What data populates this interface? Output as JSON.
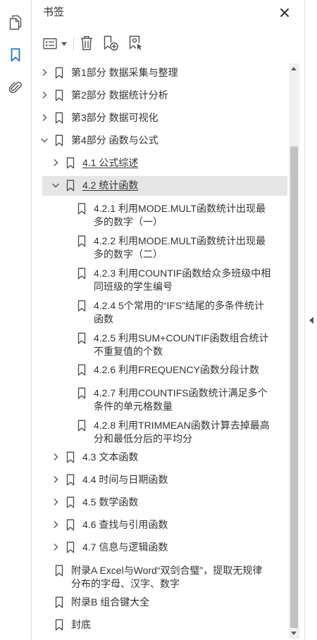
{
  "colors": {
    "accent": "#1473e6",
    "text": "#333333",
    "selection": "#e5e5e5",
    "scroll_thumb": "#c1c1c1",
    "scroll_track": "#f0f0f0"
  },
  "sidebar": {
    "tools": [
      {
        "icon": "pages-icon",
        "active": false
      },
      {
        "icon": "bookmark-icon",
        "active": true
      },
      {
        "icon": "paperclip-icon",
        "active": false
      }
    ]
  },
  "panel": {
    "title": "书签",
    "close_icon": "close-icon"
  },
  "toolbar": {
    "buttons": [
      {
        "icon": "options-icon"
      },
      {
        "icon": "dropdown-caret-icon"
      },
      {
        "icon": "trash-icon"
      },
      {
        "icon": "new-bookmark-icon"
      },
      {
        "icon": "find-current-bookmark-icon"
      }
    ]
  },
  "bookmarks": [
    {
      "depth": 0,
      "toggle_icon": "chevron-right-icon",
      "expanded": false,
      "lines": [
        "第1部分 数据采集与整理"
      ]
    },
    {
      "depth": 0,
      "toggle_icon": "chevron-right-icon",
      "expanded": false,
      "lines": [
        "第2部分 数据统计分析"
      ]
    },
    {
      "depth": 0,
      "toggle_icon": "chevron-right-icon",
      "expanded": false,
      "lines": [
        "第3部分 数据可视化"
      ]
    },
    {
      "depth": 0,
      "toggle_icon": "chevron-down-icon",
      "expanded": true,
      "lines": [
        "第4部分 函数与公式"
      ]
    },
    {
      "depth": 1,
      "toggle_icon": "chevron-right-icon",
      "expanded": false,
      "lines": [
        "4.1 公式综述"
      ]
    },
    {
      "depth": 1,
      "toggle_icon": "chevron-down-icon",
      "expanded": true,
      "selected": true,
      "lines": [
        "4.2 统计函数"
      ]
    },
    {
      "depth": 2,
      "lines": [
        "4.2.1 利用MODE.MULT函数统计出现最",
        "多的数字（一）"
      ]
    },
    {
      "depth": 2,
      "lines": [
        "4.2.2 利用MODE.MULT函数统计出现最",
        "多的数字（二）"
      ]
    },
    {
      "depth": 2,
      "lines": [
        "4.2.3 利用COUNTIF函数给众多班级中相",
        "同班级的学生编号"
      ]
    },
    {
      "depth": 2,
      "lines": [
        "4.2.4 5个常用的“IFS”结尾的多条件统计",
        "函数"
      ]
    },
    {
      "depth": 2,
      "lines": [
        "4.2.5 利用SUM+COUNTIF函数组合统计",
        "不重复值的个数"
      ]
    },
    {
      "depth": 2,
      "lines": [
        "4.2.6 利用FREQUENCY函数分段计数"
      ]
    },
    {
      "depth": 2,
      "lines": [
        "4.2.7 利用COUNTIFS函数统计满足多个",
        "条件的单元格数量"
      ]
    },
    {
      "depth": 2,
      "lines": [
        "4.2.8 利用TRIMMEAN函数计算去掉最高",
        "分和最低分后的平均分"
      ]
    },
    {
      "depth": 1,
      "toggle_icon": "chevron-right-icon",
      "expanded": false,
      "lines": [
        "4.3 文本函数"
      ]
    },
    {
      "depth": 1,
      "toggle_icon": "chevron-right-icon",
      "expanded": false,
      "lines": [
        "4.4 时间与日期函数"
      ]
    },
    {
      "depth": 1,
      "toggle_icon": "chevron-right-icon",
      "expanded": false,
      "lines": [
        "4.5 数学函数"
      ]
    },
    {
      "depth": 1,
      "toggle_icon": "chevron-right-icon",
      "expanded": false,
      "lines": [
        "4.6 查找与引用函数"
      ]
    },
    {
      "depth": 1,
      "toggle_icon": "chevron-right-icon",
      "expanded": false,
      "lines": [
        "4.7 信息与逻辑函数"
      ]
    },
    {
      "depth": 0,
      "lines": [
        "附录A Excel与Word“双剑合璧”，提取无规律",
        "分布的字母、汉字、数字"
      ]
    },
    {
      "depth": 0,
      "lines": [
        "附录B 组合键大全"
      ]
    },
    {
      "depth": 0,
      "lines": [
        "封底"
      ]
    }
  ],
  "scrollbar": {
    "up_icon": "triangle-up-icon",
    "down_icon": "triangle-down-icon"
  },
  "collapse_handle": {
    "icon": "triangle-left-icon"
  }
}
